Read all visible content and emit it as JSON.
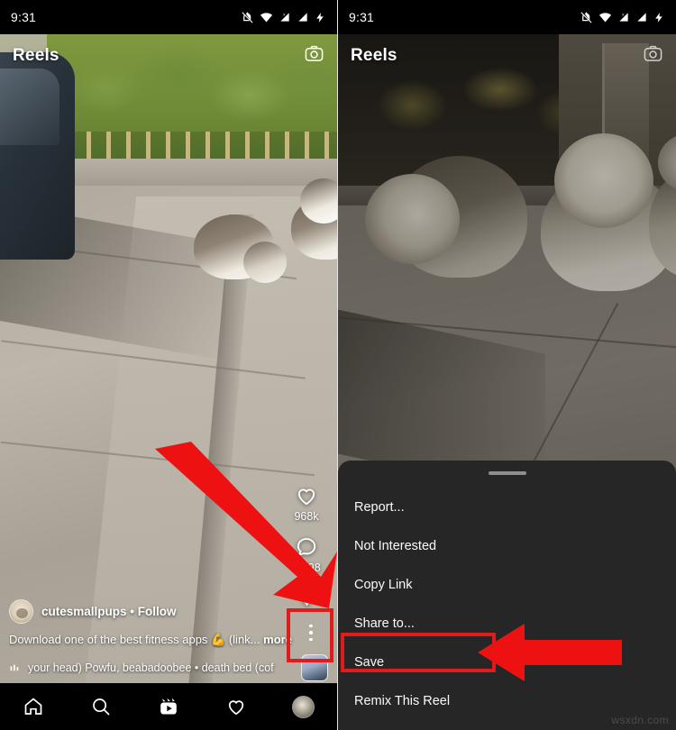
{
  "status_bar": {
    "time": "9:31",
    "icons": [
      "notifications-off-icon",
      "wifi-icon",
      "signal-1-icon",
      "signal-2-icon",
      "battery-charging-icon"
    ]
  },
  "colors": {
    "annotation_red": "#e01b1b",
    "sheet_background": "#262626",
    "nav_background": "#000000",
    "text_primary": "#fafafa"
  },
  "left_panel": {
    "header": {
      "title": "Reels",
      "camera_icon": "camera-icon"
    },
    "rail": {
      "like": {
        "icon": "heart-icon",
        "count": "968k"
      },
      "comment": {
        "icon": "comment-bubble-icon",
        "count": "9,798"
      },
      "share": {
        "icon": "send-paper-plane-icon",
        "count": ""
      }
    },
    "post": {
      "username": "cutesmallpups",
      "separator": "•",
      "follow_label": "Follow",
      "caption": "Download one of the best fitness apps 💪 (link...",
      "caption_more": "more",
      "music_icon": "audio-bars-icon",
      "music_text": "your head)   Powfu, beabadoobee • death bed (cof"
    },
    "more_button": {
      "icon": "three-dots-vertical-icon"
    }
  },
  "right_panel": {
    "header": {
      "title": "Reels",
      "camera_icon": "camera-icon"
    },
    "sheet": {
      "handle": "drag-handle",
      "items": [
        {
          "label": "Report...",
          "highlighted": false
        },
        {
          "label": "Not Interested",
          "highlighted": false
        },
        {
          "label": "Copy Link",
          "highlighted": false
        },
        {
          "label": "Share to...",
          "highlighted": false
        },
        {
          "label": "Save",
          "highlighted": true
        },
        {
          "label": "Remix This Reel",
          "highlighted": false
        }
      ]
    }
  },
  "bottom_nav": {
    "items": [
      {
        "name": "home",
        "icon": "home-icon"
      },
      {
        "name": "search",
        "icon": "search-icon"
      },
      {
        "name": "reels",
        "icon": "reels-clapper-icon"
      },
      {
        "name": "activity",
        "icon": "heart-icon"
      },
      {
        "name": "profile",
        "icon": "profile-avatar-icon"
      }
    ]
  },
  "watermark": "wsxdn.com"
}
